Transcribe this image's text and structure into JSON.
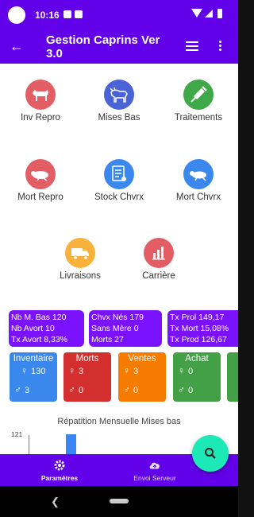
{
  "status_bar": {
    "time": "10:16"
  },
  "app_bar": {
    "title": "Gestion Caprins Ver 3.0"
  },
  "tiles": [
    {
      "label": "Inv Repro",
      "icon": "goat-icon",
      "color": "#e35d64"
    },
    {
      "label": "Mises Bas",
      "icon": "goat-birth-icon",
      "color": "#4a63d6"
    },
    {
      "label": "Traitements",
      "icon": "syringe-icon",
      "color": "#3fa848"
    },
    {
      "label": "Mort Repro",
      "icon": "dead-goat-icon",
      "color": "#e35d64"
    },
    {
      "label": "Stock Chvrx",
      "icon": "document-icon",
      "color": "#3a88ee"
    },
    {
      "label": "Mort Chvrx",
      "icon": "dead-kid-icon",
      "color": "#3a88ee"
    },
    {
      "label": "Livraisons",
      "icon": "truck-icon",
      "color": "#f8b23c"
    },
    {
      "label": "Carrière",
      "icon": "bar-chart-icon",
      "color": "#e35d64"
    }
  ],
  "stats": {
    "box1": [
      "Nb M. Bas 120",
      "Nb Avort 10",
      "Tx Avort 8,33%"
    ],
    "box2": [
      "Chvx Nés 179",
      "Sans Mère 0",
      "Morts 27"
    ],
    "box3": [
      "Tx Prol 149,17",
      "Tx Mort 15,08%",
      "Tx Prod 126,67"
    ]
  },
  "cards": [
    {
      "title": "Inventaire",
      "female": "130",
      "male": "3",
      "color": "#3a88ee"
    },
    {
      "title": "Morts",
      "female": "3",
      "male": "0",
      "color": "#d32f2f"
    },
    {
      "title": "Ventes",
      "female": "3",
      "male": "0",
      "color": "#f57c00"
    },
    {
      "title": "Achat",
      "female": "0",
      "male": "0",
      "color": "#43a047"
    }
  ],
  "chart_data": {
    "type": "bar",
    "title": "Répatition Mensuelle Mises bas",
    "y_tick_top": "121"
  },
  "bottom_nav": {
    "settings": "Paramètres",
    "upload": "Envoi Serveur"
  },
  "colors": {
    "primary": "#6200ea",
    "fab": "#1de9b6",
    "stat_box": "#7a12ff"
  }
}
